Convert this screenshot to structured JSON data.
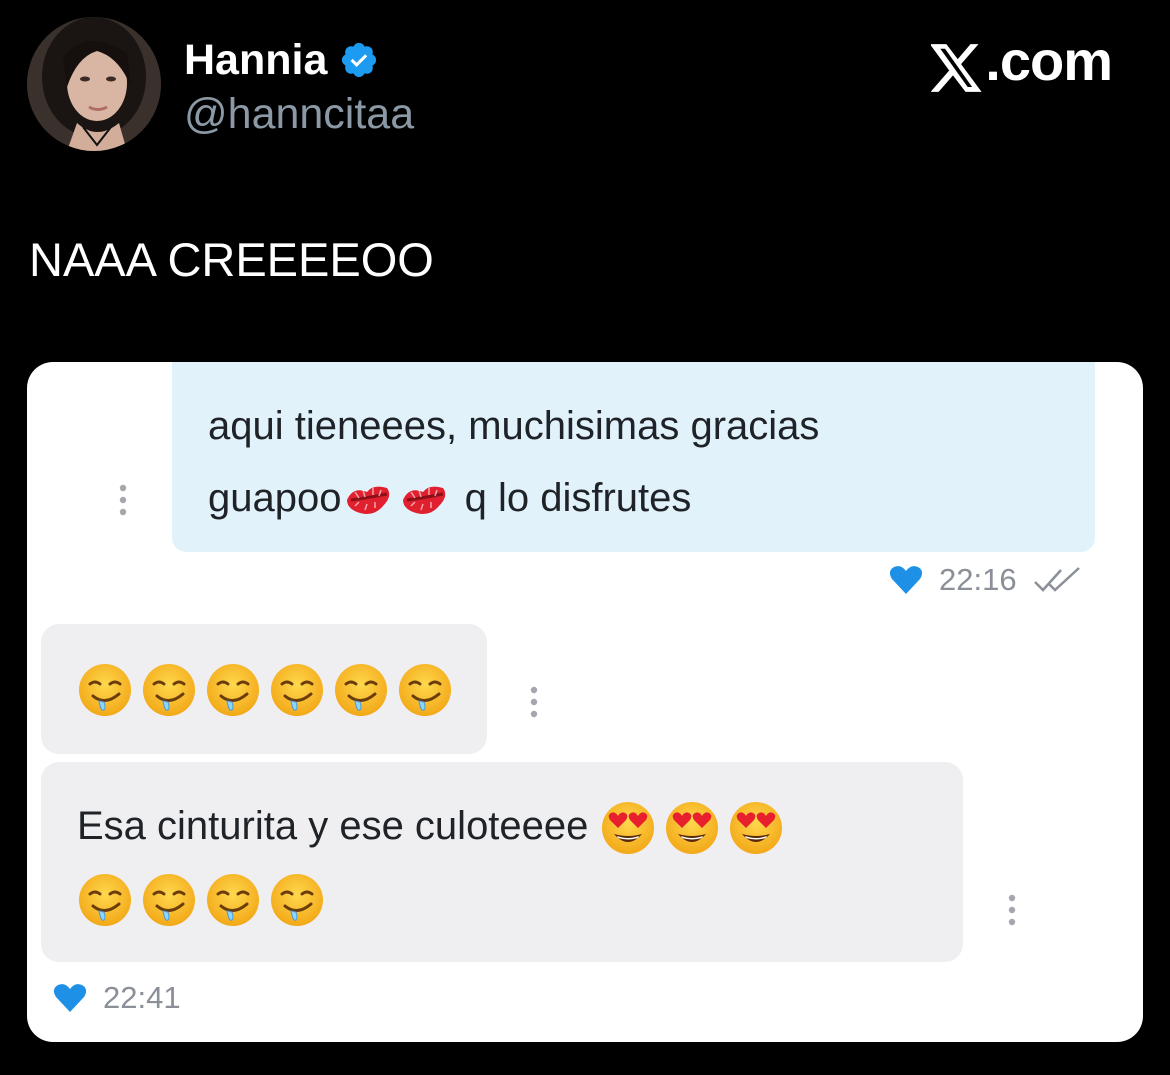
{
  "post": {
    "author": {
      "display_name": "Hannia",
      "handle": "@hanncitaa",
      "verified": true,
      "avatar_icon": "profile-photo"
    },
    "brand": "X.com",
    "text": "NAAA CREEEEOO"
  },
  "screenshot": {
    "messages": [
      {
        "direction": "outgoing",
        "line1": "aqui tieneees, muchisimas gracias",
        "line2_prefix": "guapoo",
        "line2_icons": [
          "kiss-mark-icon",
          "kiss-mark-icon"
        ],
        "line2_suffix": " q lo disfrutes",
        "time": "22:16",
        "liked": true,
        "read": true
      },
      {
        "direction": "incoming",
        "icons": [
          "drooling-face-icon",
          "drooling-face-icon",
          "drooling-face-icon",
          "drooling-face-icon",
          "drooling-face-icon",
          "drooling-face-icon"
        ]
      },
      {
        "direction": "incoming",
        "text": "Esa cinturita y ese culoteeee ",
        "icons_line1": [
          "heart-eyes-face-icon",
          "heart-eyes-face-icon",
          "heart-eyes-face-icon"
        ],
        "icons_line2": [
          "drooling-face-icon",
          "drooling-face-icon",
          "drooling-face-icon",
          "drooling-face-icon"
        ],
        "time": "22:41",
        "liked": true
      }
    ]
  },
  "colors": {
    "background": "#000000",
    "handle_gray": "#8b98a5",
    "verified_blue": "#1d9bf0",
    "outgoing_bubble": "#e1f2fb",
    "incoming_bubble": "#efeff1",
    "heart_blue": "#1e90e6"
  }
}
